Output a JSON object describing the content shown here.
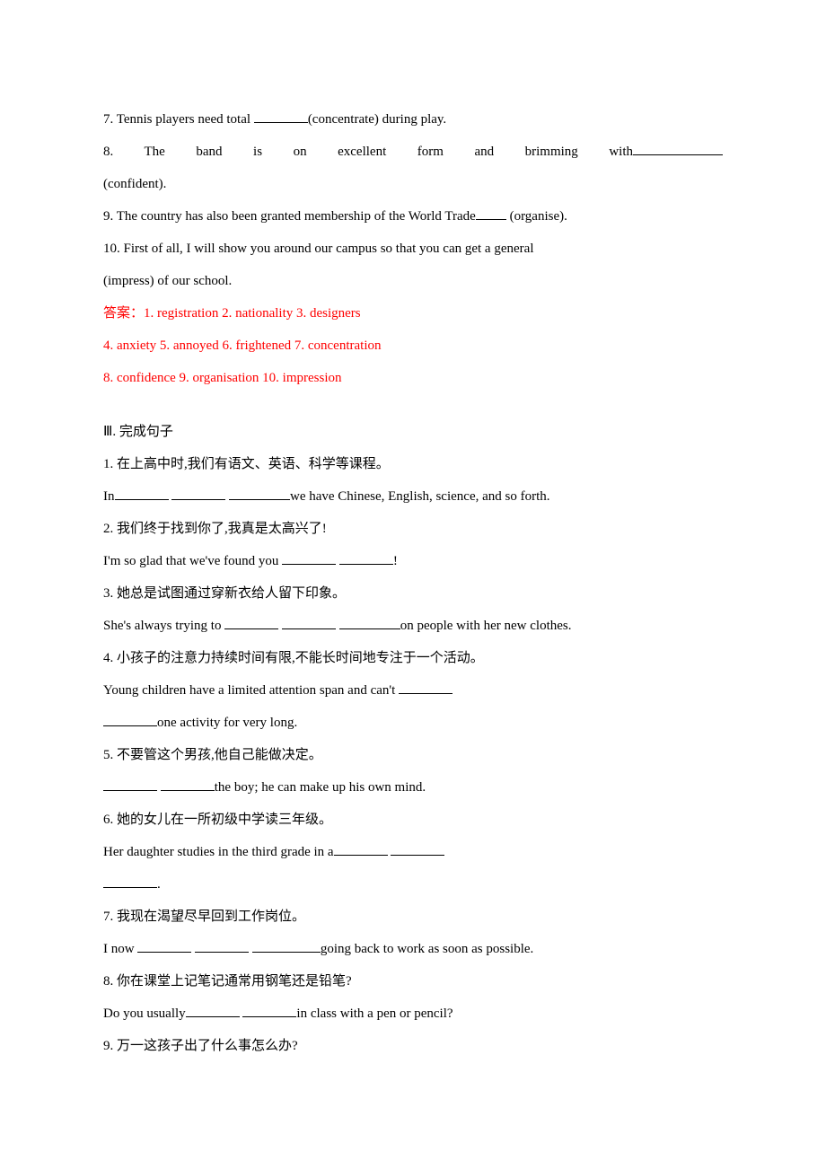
{
  "q7": {
    "pre": "7. Tennis players need total ",
    "post": "(concentrate) during play."
  },
  "q8": {
    "pre": "8.  The  band  is  on  excellent  form  and  brimming  with",
    "post": "(confident)."
  },
  "q9": {
    "pre": "9. The country has also been granted membership of the World Trade",
    "post": " (organise)."
  },
  "q10": {
    "pre": "10. First of all, I will show you around our campus so that you can get a general",
    "post": "(impress) of our school."
  },
  "answers": {
    "label": "答案：",
    "line1": "1. registration  2. nationality  3. designers",
    "line2": "4. anxiety  5. annoyed  6. frightened  7. concentration",
    "line3": "8. confidence  9. organisation  10. impression"
  },
  "section3": {
    "title": "Ⅲ. 完成句子",
    "items": [
      {
        "cn": "1. 在上高中时,我们有语文、英语、科学等课程。",
        "en_pre": "In",
        "en_post": "we have Chinese, English, science, and so forth.",
        "blanks": 3
      },
      {
        "cn": "2. 我们终于找到你了,我真是太高兴了!",
        "en_pre": "I'm so glad that we've found you ",
        "en_post": "!",
        "blanks": 2
      },
      {
        "cn": "3. 她总是试图通过穿新衣给人留下印象。",
        "en_pre": "She's always trying to ",
        "en_post": "on people with her new clothes.",
        "blanks": 3
      },
      {
        "cn": "4. 小孩子的注意力持续时间有限,不能长时间地专注于一个活动。",
        "en_pre": "Young children have a limited attention span and can't ",
        "en_line2_post": "one activity for very long.",
        "blanks_line1": 1,
        "blanks_line2": 1
      },
      {
        "cn": "5. 不要管这个男孩,他自己能做决定。",
        "en_post": "the boy; he can make up his own mind.",
        "blanks": 2
      },
      {
        "cn": "6. 她的女儿在一所初级中学读三年级。",
        "en_pre": "Her daughter studies in the third grade in a",
        "en_line2_post": ".",
        "blanks_line1": 2,
        "blanks_line2": 1
      },
      {
        "cn": "7. 我现在渴望尽早回到工作岗位。",
        "en_pre": "I now ",
        "en_post": "going back to work as soon as possible.",
        "blanks": 3
      },
      {
        "cn": "8. 你在课堂上记笔记通常用钢笔还是铅笔?",
        "en_pre": "Do you usually",
        "en_post": "in class with a pen or pencil?",
        "blanks": 2
      },
      {
        "cn": "9. 万一这孩子出了什么事怎么办?"
      }
    ]
  }
}
